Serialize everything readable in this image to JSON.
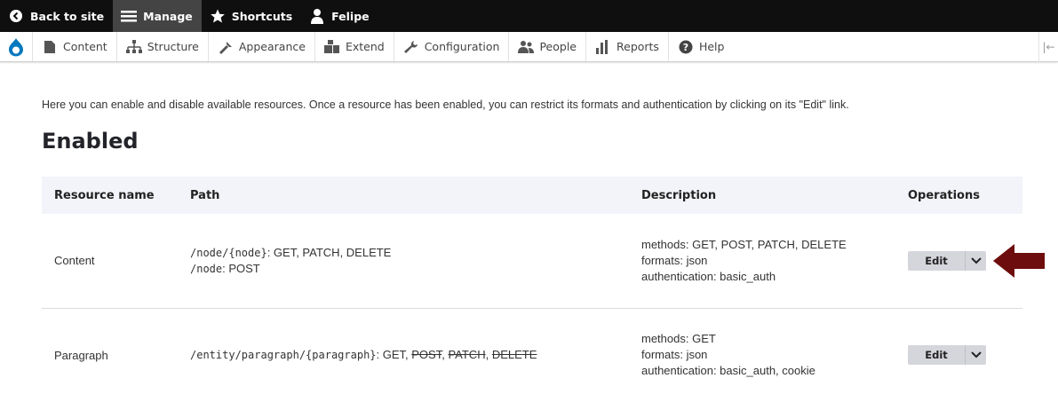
{
  "toolbar": {
    "back_label": "Back to site",
    "manage_label": "Manage",
    "shortcuts_label": "Shortcuts",
    "user_label": "Felipe"
  },
  "tray": {
    "items": [
      {
        "label": "Content",
        "icon": "content-icon"
      },
      {
        "label": "Structure",
        "icon": "structure-icon"
      },
      {
        "label": "Appearance",
        "icon": "appearance-icon"
      },
      {
        "label": "Extend",
        "icon": "extend-icon"
      },
      {
        "label": "Configuration",
        "icon": "wrench-icon"
      },
      {
        "label": "People",
        "icon": "people-icon"
      },
      {
        "label": "Reports",
        "icon": "reports-icon"
      },
      {
        "label": "Help",
        "icon": "help-icon"
      }
    ]
  },
  "main": {
    "intro": "Here you can enable and disable available resources. Once a resource has been enabled, you can restrict its formats and authentication by clicking on its \"Edit\" link.",
    "heading": "Enabled",
    "columns": [
      "Resource name",
      "Path",
      "Description",
      "Operations"
    ],
    "rows": [
      {
        "name": "Content",
        "path_line1_mono": "/node/{node}",
        "path_line1_rest": ": GET, PATCH, DELETE",
        "path_line2_mono": "/node",
        "path_line2_rest": ": POST",
        "desc": [
          "methods: GET, POST, PATCH, DELETE",
          "formats: json",
          "authentication: basic_auth"
        ],
        "edit_label": "Edit"
      },
      {
        "name": "Paragraph",
        "path_mono": "/entity/paragraph/{paragraph}",
        "path_rest": ": GET, ",
        "path_struck": [
          "POST",
          "PATCH",
          "DELETE"
        ],
        "desc": [
          "methods: GET",
          "formats: json",
          "authentication: basic_auth, cookie"
        ],
        "edit_label": "Edit"
      }
    ]
  },
  "colors": {
    "toolbar_bg": "#0f0f0f",
    "drupal_blue": "#0678be",
    "arrow": "#6e0d0d",
    "header_row_bg": "#f3f4f9"
  }
}
